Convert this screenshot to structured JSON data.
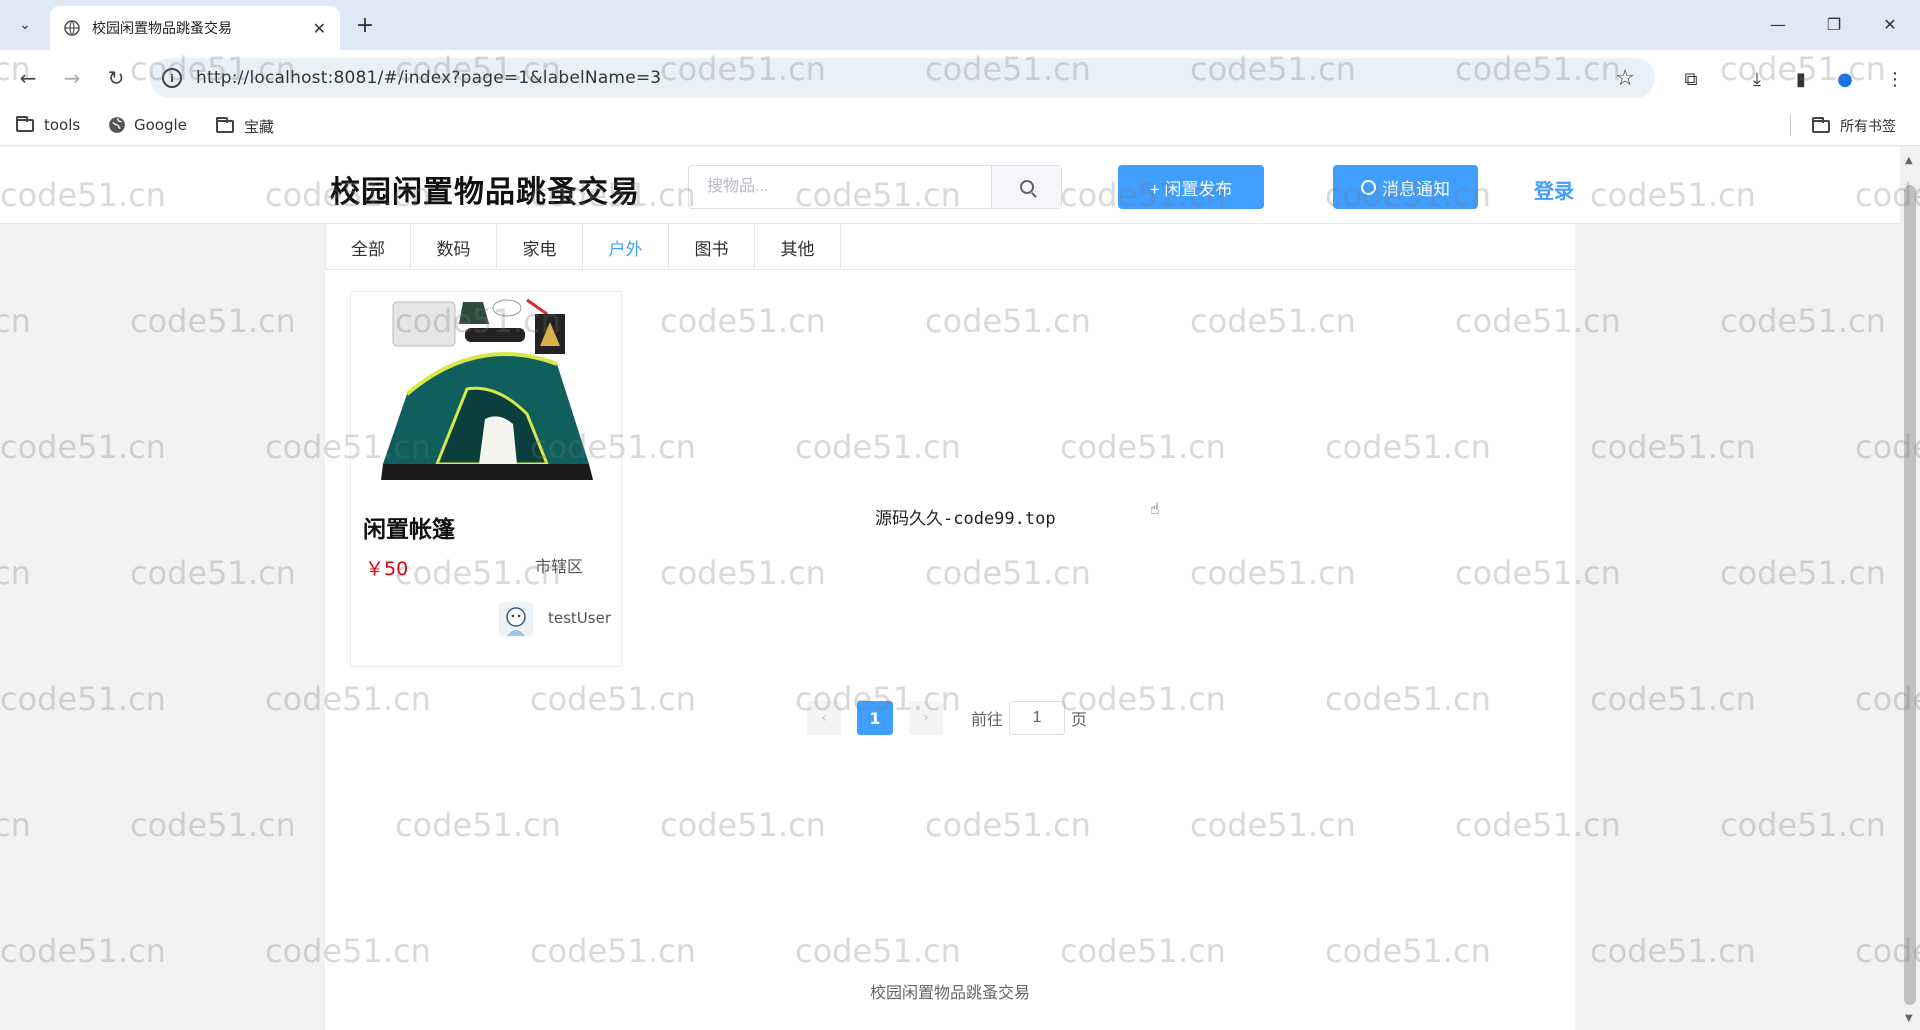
{
  "browser": {
    "tab_title": "校园闲置物品跳蚤交易",
    "url": "http://localhost:8081/#/index?page=1&labelName=3",
    "bookmarks": [
      {
        "label": "tools",
        "icon": "folder-icon"
      },
      {
        "label": "Google",
        "icon": "globe-icon"
      },
      {
        "label": "宝藏",
        "icon": "folder-icon"
      }
    ],
    "all_bookmarks_label": "所有书签"
  },
  "header": {
    "site_title": "校园闲置物品跳蚤交易",
    "search_placeholder": "搜物品...",
    "publish_label": "+ 闲置发布",
    "notify_label": "消息通知",
    "login_label": "登录"
  },
  "categories": [
    "全部",
    "数码",
    "家电",
    "户外",
    "图书",
    "其他"
  ],
  "active_category": "户外",
  "items": [
    {
      "name": "闲置帐篷",
      "price": "￥50",
      "location": "市辖区",
      "user": "testUser",
      "image": "tent-icon"
    }
  ],
  "center_note": "源码久久-code99.top",
  "pagination": {
    "current": "1",
    "goto_prefix": "前往",
    "goto_value": "1",
    "goto_suffix": "页"
  },
  "footer": "校园闲置物品跳蚤交易",
  "watermark": "code51.cn",
  "colors": {
    "primary": "#409eff",
    "price": "#e60012"
  }
}
